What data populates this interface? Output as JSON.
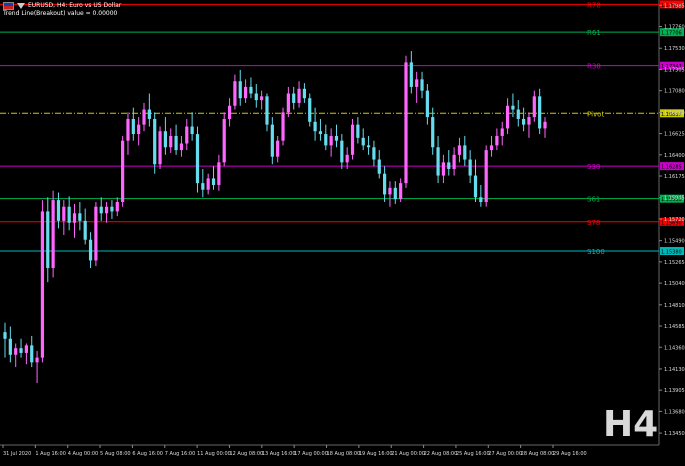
{
  "header": {
    "title": "EURUSD, H4:  Euro vs US Dollar",
    "indicator": "Trend Line(Breakout)  value = 0.00000",
    "flag_icon": "eu-us-flag-icon",
    "arrow_icon": "arrow-down-icon"
  },
  "timeframe_label": "H4",
  "colors": {
    "background": "#000000",
    "bull": "#ff66ff",
    "bear": "#66ddee",
    "r78": "#ff0000",
    "r61": "#00b050",
    "r38": "#cc00cc",
    "pivot": "#cccc00",
    "s38": "#cc00cc",
    "s61": "#00b050",
    "s78": "#ff0000",
    "s100": "#00b8b8",
    "axis_text": "#dddddd"
  },
  "chart_data": {
    "type": "candlestick",
    "symbol": "EURUSD",
    "timeframe": "H4",
    "ylim": [
      1.13345,
      1.1802
    ],
    "y_ticks": [
      "1.17985",
      "1.17760",
      "1.17530",
      "1.17305",
      "1.17080",
      "1.16850",
      "1.16625",
      "1.16400",
      "1.16175",
      "1.15945",
      "1.15720",
      "1.15490",
      "1.15265",
      "1.15040",
      "1.14810",
      "1.14585",
      "1.14360",
      "1.14130",
      "1.13905",
      "1.13680",
      "1.13450"
    ],
    "x_ticks": [
      "31 Jul 2020",
      "1 Aug 16:00",
      "4 Aug 00:00",
      "5 Aug 08:00",
      "6 Aug 16:00",
      "7 Aug 16:00",
      "11 Aug 00:00",
      "12 Aug 08:00",
      "13 Aug 16:00",
      "17 Aug 00:00",
      "18 Aug 08:00",
      "19 Aug 16:00",
      "21 Aug 00:00",
      "22 Aug 08:00",
      "25 Aug 16:00",
      "27 Aug 00:00",
      "28 Aug 08:00",
      "29 Aug 16:00"
    ],
    "levels": [
      {
        "label": "R78",
        "value": 1.17995,
        "price": "1.17995",
        "color_key": "r78",
        "style": "solid"
      },
      {
        "label": "R61",
        "value": 1.177,
        "price": "1.17706",
        "color_key": "r61",
        "style": "solid"
      },
      {
        "label": "R38",
        "value": 1.17345,
        "price": "1.17347",
        "color_key": "r38",
        "style": "solid"
      },
      {
        "label": "Pivot",
        "value": 1.1684,
        "price": "1.16837",
        "color_key": "pivot",
        "style": "dashdot"
      },
      {
        "label": "S38",
        "value": 1.1628,
        "price": "1.16285",
        "color_key": "s38",
        "style": "solid"
      },
      {
        "label": "S61",
        "value": 1.15935,
        "price": "1.15935",
        "color_key": "s61",
        "style": "solid"
      },
      {
        "label": "S78",
        "value": 1.1569,
        "price": "1.15690",
        "color_key": "s78",
        "style": "solid"
      },
      {
        "label": "S100",
        "value": 1.1538,
        "price": "1.15380",
        "color_key": "s100",
        "style": "solid"
      }
    ],
    "candles": [
      [
        1.1452,
        1.1462,
        1.1425,
        1.1445
      ],
      [
        1.1445,
        1.1458,
        1.142,
        1.1428
      ],
      [
        1.1428,
        1.144,
        1.1415,
        1.1435
      ],
      [
        1.1435,
        1.1445,
        1.1425,
        1.143
      ],
      [
        1.143,
        1.144,
        1.1418,
        1.1438
      ],
      [
        1.1438,
        1.1448,
        1.1415,
        1.142
      ],
      [
        1.142,
        1.1432,
        1.1398,
        1.1425
      ],
      [
        1.1425,
        1.1592,
        1.142,
        1.158
      ],
      [
        1.158,
        1.1595,
        1.1505,
        1.152
      ],
      [
        1.152,
        1.1602,
        1.151,
        1.1592
      ],
      [
        1.1592,
        1.16,
        1.1562,
        1.157
      ],
      [
        1.157,
        1.1592,
        1.1555,
        1.1585
      ],
      [
        1.1585,
        1.1596,
        1.156,
        1.1568
      ],
      [
        1.1568,
        1.1588,
        1.1552,
        1.1578
      ],
      [
        1.1578,
        1.159,
        1.156,
        1.157
      ],
      [
        1.157,
        1.1583,
        1.1545,
        1.155
      ],
      [
        1.155,
        1.1558,
        1.152,
        1.1528
      ],
      [
        1.1528,
        1.159,
        1.1522,
        1.1585
      ],
      [
        1.1585,
        1.1595,
        1.157,
        1.1578
      ],
      [
        1.1578,
        1.159,
        1.1568,
        1.1585
      ],
      [
        1.1585,
        1.1592,
        1.1572,
        1.158
      ],
      [
        1.158,
        1.1595,
        1.1575,
        1.159
      ],
      [
        1.159,
        1.166,
        1.1585,
        1.1655
      ],
      [
        1.1655,
        1.1685,
        1.164,
        1.1678
      ],
      [
        1.1678,
        1.169,
        1.1655,
        1.1662
      ],
      [
        1.1662,
        1.168,
        1.165,
        1.1672
      ],
      [
        1.1672,
        1.1695,
        1.1665,
        1.1688
      ],
      [
        1.1688,
        1.1705,
        1.167,
        1.1678
      ],
      [
        1.1678,
        1.1685,
        1.162,
        1.163
      ],
      [
        1.163,
        1.167,
        1.1625,
        1.1665
      ],
      [
        1.1665,
        1.168,
        1.164,
        1.1648
      ],
      [
        1.1648,
        1.1668,
        1.1642,
        1.166
      ],
      [
        1.166,
        1.1672,
        1.164,
        1.1645
      ],
      [
        1.1645,
        1.166,
        1.1638,
        1.1652
      ],
      [
        1.1652,
        1.1678,
        1.1645,
        1.167
      ],
      [
        1.167,
        1.1685,
        1.1655,
        1.1662
      ],
      [
        1.1662,
        1.167,
        1.16,
        1.161
      ],
      [
        1.161,
        1.1625,
        1.1595,
        1.1603
      ],
      [
        1.1603,
        1.162,
        1.1598,
        1.1615
      ],
      [
        1.1615,
        1.1628,
        1.1603,
        1.1608
      ],
      [
        1.1608,
        1.164,
        1.1602,
        1.1632
      ],
      [
        1.1632,
        1.1685,
        1.1628,
        1.1678
      ],
      [
        1.1678,
        1.17,
        1.167,
        1.1692
      ],
      [
        1.1692,
        1.1725,
        1.1688,
        1.1718
      ],
      [
        1.1718,
        1.173,
        1.1692,
        1.17
      ],
      [
        1.17,
        1.172,
        1.1695,
        1.1712
      ],
      [
        1.1712,
        1.1722,
        1.17,
        1.1705
      ],
      [
        1.1705,
        1.1715,
        1.169,
        1.1698
      ],
      [
        1.1698,
        1.1708,
        1.1688,
        1.1702
      ],
      [
        1.1702,
        1.1705,
        1.1665,
        1.1672
      ],
      [
        1.1672,
        1.168,
        1.163,
        1.1638
      ],
      [
        1.1638,
        1.166,
        1.1632,
        1.1655
      ],
      [
        1.1655,
        1.169,
        1.165,
        1.1685
      ],
      [
        1.1685,
        1.1712,
        1.168,
        1.1705
      ],
      [
        1.1705,
        1.1712,
        1.1688,
        1.1695
      ],
      [
        1.1695,
        1.1718,
        1.169,
        1.171
      ],
      [
        1.171,
        1.1716,
        1.1695,
        1.17
      ],
      [
        1.17,
        1.1705,
        1.167,
        1.1675
      ],
      [
        1.1675,
        1.169,
        1.1655,
        1.1665
      ],
      [
        1.1665,
        1.1678,
        1.1655,
        1.1662
      ],
      [
        1.1662,
        1.1672,
        1.1645,
        1.165
      ],
      [
        1.165,
        1.1668,
        1.1638,
        1.166
      ],
      [
        1.166,
        1.1672,
        1.1648,
        1.1655
      ],
      [
        1.1655,
        1.1662,
        1.1625,
        1.1632
      ],
      [
        1.1632,
        1.1648,
        1.1625,
        1.164
      ],
      [
        1.164,
        1.1678,
        1.1635,
        1.1672
      ],
      [
        1.1672,
        1.168,
        1.1652,
        1.1658
      ],
      [
        1.1658,
        1.1668,
        1.1645,
        1.165
      ],
      [
        1.165,
        1.166,
        1.164,
        1.1648
      ],
      [
        1.1648,
        1.1655,
        1.1628,
        1.1635
      ],
      [
        1.1635,
        1.1645,
        1.1615,
        1.162
      ],
      [
        1.162,
        1.1628,
        1.159,
        1.1598
      ],
      [
        1.1598,
        1.1612,
        1.1585,
        1.1605
      ],
      [
        1.1605,
        1.1612,
        1.1588,
        1.1593
      ],
      [
        1.1593,
        1.1615,
        1.159,
        1.161
      ],
      [
        1.161,
        1.1745,
        1.1605,
        1.1738
      ],
      [
        1.1738,
        1.175,
        1.1705,
        1.1712
      ],
      [
        1.1712,
        1.1728,
        1.1695,
        1.172
      ],
      [
        1.172,
        1.1728,
        1.17,
        1.1708
      ],
      [
        1.1708,
        1.1715,
        1.1672,
        1.168
      ],
      [
        1.168,
        1.169,
        1.164,
        1.1648
      ],
      [
        1.1648,
        1.166,
        1.161,
        1.1618
      ],
      [
        1.1618,
        1.164,
        1.161,
        1.1632
      ],
      [
        1.1632,
        1.1645,
        1.1618,
        1.1625
      ],
      [
        1.1625,
        1.1648,
        1.1618,
        1.164
      ],
      [
        1.164,
        1.1658,
        1.1632,
        1.165
      ],
      [
        1.165,
        1.166,
        1.1628,
        1.1635
      ],
      [
        1.1635,
        1.1645,
        1.161,
        1.1618
      ],
      [
        1.1618,
        1.1635,
        1.159,
        1.1595
      ],
      [
        1.1595,
        1.1608,
        1.1585,
        1.159
      ],
      [
        1.159,
        1.165,
        1.1585,
        1.1645
      ],
      [
        1.1645,
        1.166,
        1.1638,
        1.165
      ],
      [
        1.165,
        1.1668,
        1.1645,
        1.166
      ],
      [
        1.166,
        1.1675,
        1.165,
        1.1668
      ],
      [
        1.1668,
        1.17,
        1.1662,
        1.1692
      ],
      [
        1.1692,
        1.1705,
        1.168,
        1.1688
      ],
      [
        1.1688,
        1.1698,
        1.167,
        1.1678
      ],
      [
        1.1678,
        1.169,
        1.1665,
        1.1672
      ],
      [
        1.1672,
        1.1685,
        1.1658,
        1.168
      ],
      [
        1.168,
        1.1708,
        1.1675,
        1.1702
      ],
      [
        1.1702,
        1.171,
        1.1662,
        1.1668
      ],
      [
        1.1668,
        1.168,
        1.1658,
        1.1675
      ]
    ]
  }
}
